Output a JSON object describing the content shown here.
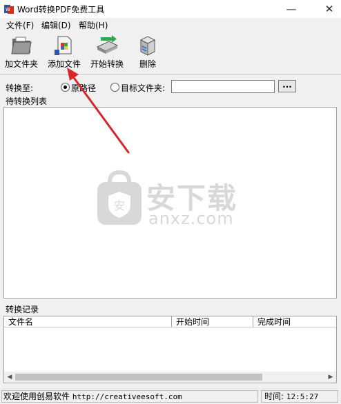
{
  "window": {
    "title": "Word转换PDF免费工具",
    "minimize_glyph": "—",
    "close_glyph": "✕"
  },
  "menu": {
    "file": "文件(F)",
    "edit": "编辑(D)",
    "help": "帮助(H)"
  },
  "toolbar": {
    "add_folder": "加文件夹",
    "add_file": "添加文件",
    "start": "开始转换",
    "delete": "删除"
  },
  "convert": {
    "label": "转换至:",
    "option_original": "原路径",
    "option_target": "目标文件夹:",
    "selected": "原路径",
    "target_value": "",
    "browse": "..."
  },
  "pending": {
    "label": "待转换列表",
    "items": []
  },
  "records": {
    "label": "转换记录",
    "columns": [
      "文件名",
      "开始时间",
      "完成时间"
    ],
    "rows": []
  },
  "statusbar": {
    "prefix": "欢迎使用创易软件",
    "url": "http://creativeesoft.com",
    "time_label": "时间:",
    "time_value": "12:5:27"
  },
  "watermark": {
    "text": "安下载",
    "sub": "anxz.com"
  },
  "colors": {
    "annotation_arrow": "#d9262b"
  },
  "icons": [
    "app-icon",
    "folder-icon",
    "add-file-icon",
    "convert-icon",
    "delete-icon",
    "shield-bag-icon"
  ]
}
